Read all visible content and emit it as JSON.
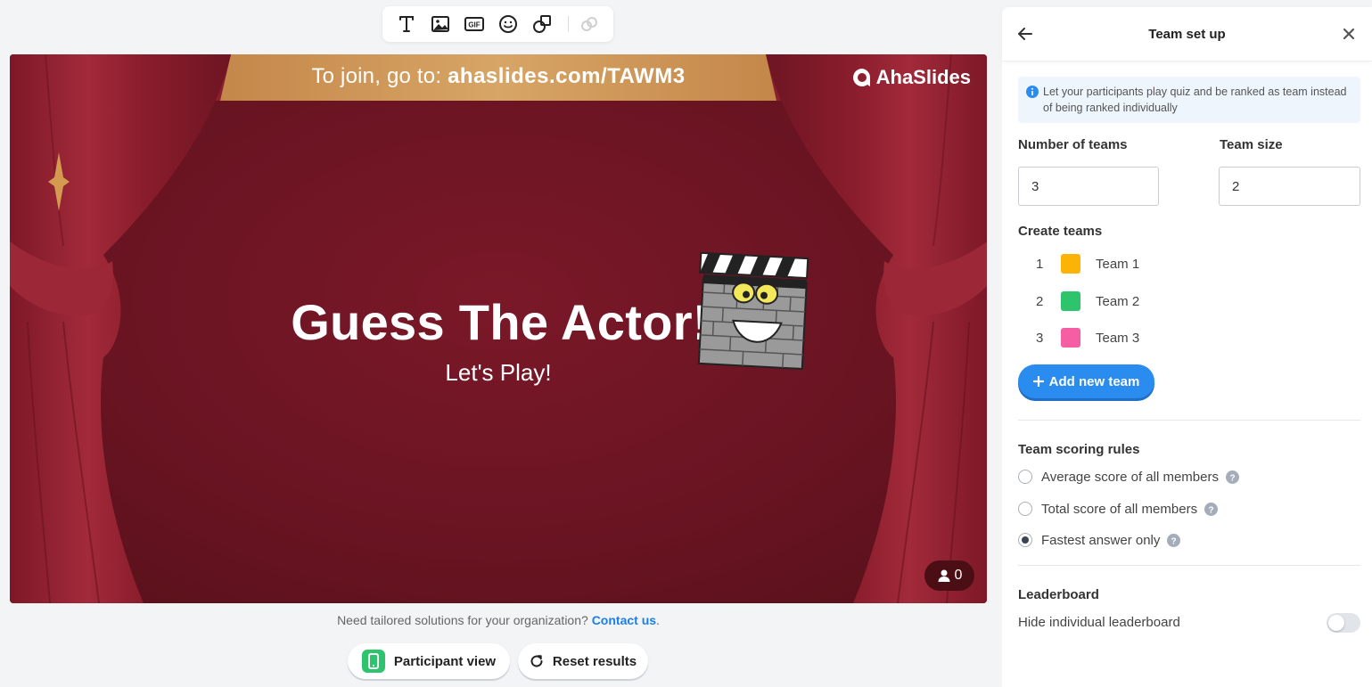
{
  "toolbar": {
    "tools": [
      "text-icon",
      "image-icon",
      "gif-icon",
      "emoji-icon",
      "shapes-icon",
      "link-icon"
    ]
  },
  "slide": {
    "join_prefix": "To join, go to: ",
    "join_url": "ahaslides.com/TAWM3",
    "brand": "AhaSlides",
    "title": "Guess The Actor!",
    "subtitle": "Let's Play!",
    "participant_count": "0"
  },
  "footer": {
    "note": "Need tailored solutions for your organization? ",
    "contact_link": "Contact us",
    "note_end": ".",
    "participant_view": "Participant view",
    "reset_results": "Reset results"
  },
  "panel": {
    "title": "Team set up",
    "info": "Let your participants play quiz and be ranked as team instead of being ranked individually",
    "num_teams_label": "Number of teams",
    "num_teams_value": "3",
    "team_size_label": "Team size",
    "team_size_value": "2",
    "create_teams_label": "Create teams",
    "teams": [
      {
        "num": "1",
        "name": "Team 1",
        "color": "#fbb306"
      },
      {
        "num": "2",
        "name": "Team 2",
        "color": "#2ec46d"
      },
      {
        "num": "3",
        "name": "Team 3",
        "color": "#f65ea4"
      }
    ],
    "add_team": "Add new team",
    "scoring_label": "Team scoring rules",
    "scoring_options": [
      {
        "label": "Average score of all members",
        "selected": false
      },
      {
        "label": "Total score of all members",
        "selected": false
      },
      {
        "label": "Fastest answer only",
        "selected": true
      }
    ],
    "leaderboard_label": "Leaderboard",
    "hide_leaderboard": "Hide individual leaderboard",
    "hide_leaderboard_on": false
  },
  "colors": {
    "accent": "#2b8cef",
    "slide_bg": "#6a1422",
    "curtain": "#8f1f2e",
    "banner_gold": "#c08a4a"
  }
}
